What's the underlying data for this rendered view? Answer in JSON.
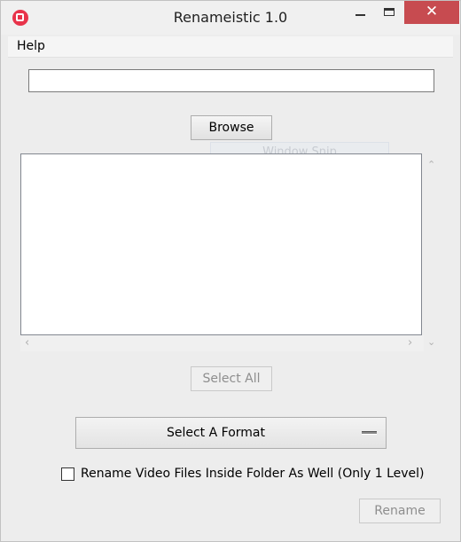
{
  "window": {
    "title": "Renameistic 1.0"
  },
  "menu": {
    "help": "Help"
  },
  "path_input": {
    "value": ""
  },
  "buttons": {
    "browse": "Browse",
    "select_all": "Select All",
    "rename": "Rename"
  },
  "overlay": {
    "window_snip": "Window Snip"
  },
  "format_select": {
    "selected": "Select A Format"
  },
  "options": {
    "recurse_label": "Rename Video Files Inside Folder As Well (Only 1 Level)",
    "recurse_checked": false
  },
  "title_buttons": {
    "close": "✕"
  },
  "scroll_glyphs": {
    "up": "⌃",
    "down": "⌄",
    "left": "‹",
    "right": "›"
  },
  "icons": [
    "app-icon",
    "minimize-icon",
    "maximize-icon",
    "close-icon",
    "scroll-up-icon",
    "scroll-down-icon",
    "scroll-left-icon",
    "scroll-right-icon",
    "dropdown-handle-icon"
  ],
  "colors": {
    "close_button": "#c74b50",
    "app_icon": "#e8334a",
    "window_bg": "#ededed"
  }
}
